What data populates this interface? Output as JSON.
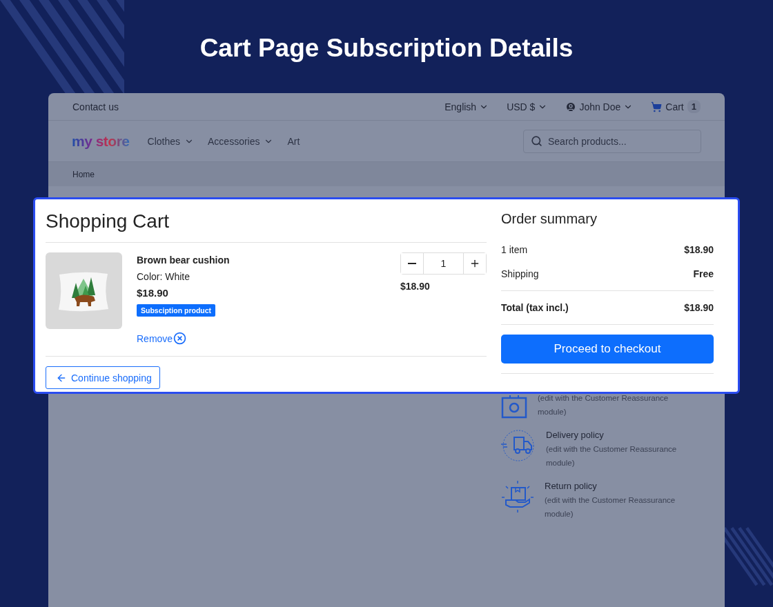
{
  "banner": {
    "title": "Cart Page Subscription Details"
  },
  "top_bar": {
    "contact": "Contact us",
    "language": "English",
    "currency": "USD $",
    "user": "John Doe",
    "cart": {
      "label": "Cart",
      "count": "1"
    }
  },
  "header": {
    "logo": "my store",
    "nav": [
      {
        "label": "Clothes",
        "dropdown": true
      },
      {
        "label": "Accessories",
        "dropdown": true
      },
      {
        "label": "Art",
        "dropdown": false
      }
    ],
    "search": {
      "placeholder": "Search products..."
    }
  },
  "breadcrumb": [
    "Home"
  ],
  "cart": {
    "title": "Shopping Cart",
    "items": [
      {
        "name": "Brown bear cushion",
        "variant": "Color: White",
        "price": "$18.90",
        "badge": "Subsciption product",
        "remove": "Remove",
        "quantity": "1",
        "total": "$18.90"
      }
    ],
    "continue": "Continue shopping"
  },
  "summary": {
    "title": "Order summary",
    "lines": [
      {
        "kind": "line",
        "label": "1 item",
        "value": "$18.90"
      },
      {
        "kind": "line",
        "label": "Shipping",
        "value": "Free"
      },
      {
        "kind": "total",
        "label": "Total (tax incl.)",
        "value": "$18.90"
      }
    ],
    "checkout": "Proceed to checkout"
  },
  "reassurance": [
    {
      "kind": "bag",
      "description": "(edit with the Customer Reassurance module)"
    },
    {
      "kind": "truck",
      "title": "Delivery policy",
      "description": "(edit with the Customer Reassurance module)"
    },
    {
      "kind": "hand",
      "title": "Return policy",
      "description": "(edit with the Customer Reassurance module)"
    }
  ]
}
